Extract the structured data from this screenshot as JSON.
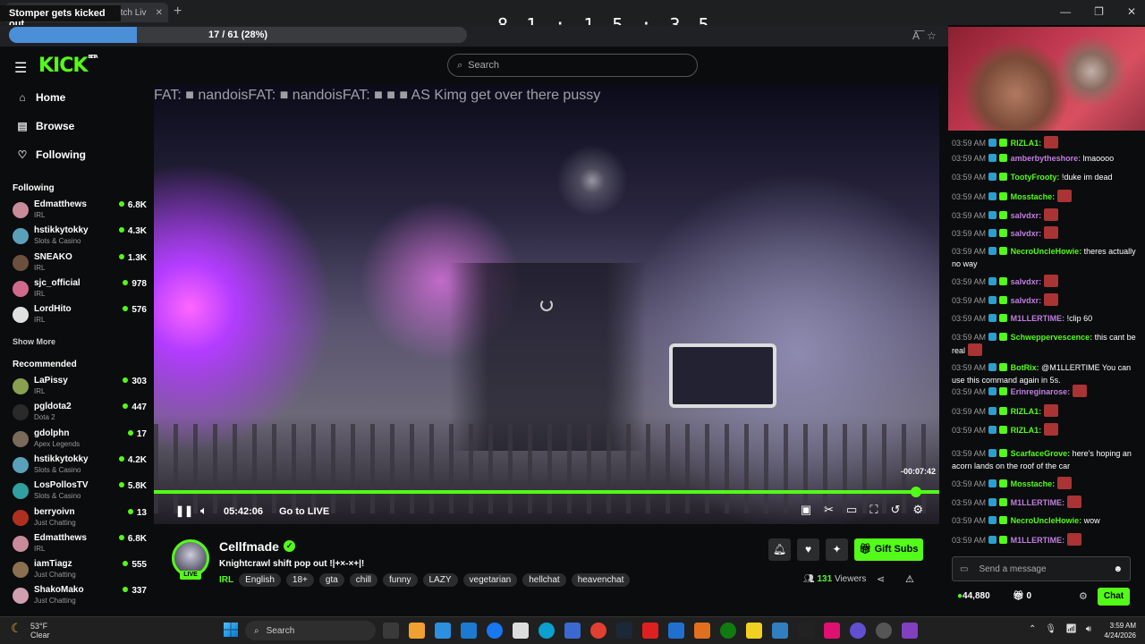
{
  "browser": {
    "tab_title": "Watch Liv",
    "overlay_title": "Stomper gets kicked out",
    "counter": "8 1 : 1 5 : 3 5",
    "progress_label": "17 / 61 (28%)",
    "progress_fraction": 0.28
  },
  "header": {
    "logo": "KICK",
    "logo_badge": "BETA",
    "search_placeholder": "Search"
  },
  "sidebar": {
    "nav": [
      {
        "label": "Home",
        "icon": "home-icon"
      },
      {
        "label": "Browse",
        "icon": "browse-icon"
      },
      {
        "label": "Following",
        "icon": "heart-icon"
      }
    ],
    "following_title": "Following",
    "following": [
      {
        "name": "Edmatthews",
        "category": "IRL",
        "viewers": "6.8K",
        "color": "#c98a9a"
      },
      {
        "name": "hstikkytokky",
        "category": "Slots & Casino",
        "viewers": "4.3K",
        "color": "#5aa0b8"
      },
      {
        "name": "SNEAKO",
        "category": "IRL",
        "viewers": "1.3K",
        "color": "#6b5040"
      },
      {
        "name": "sjc_official",
        "category": "IRL",
        "viewers": "978",
        "color": "#d06a8a"
      },
      {
        "name": "LordHito",
        "category": "IRL",
        "viewers": "576",
        "color": "#e0e0e0"
      }
    ],
    "show_more": "Show More",
    "recommended_title": "Recommended",
    "recommended": [
      {
        "name": "LaPissy",
        "category": "IRL",
        "viewers": "303",
        "color": "#8aa050"
      },
      {
        "name": "pgldota2",
        "category": "Dota 2",
        "viewers": "447",
        "color": "#2a2a2a"
      },
      {
        "name": "gdolphn",
        "category": "Apex Legends",
        "viewers": "17",
        "color": "#7a6a5a"
      },
      {
        "name": "hstikkytokky",
        "category": "Slots & Casino",
        "viewers": "4.2K",
        "color": "#5aa0b8"
      },
      {
        "name": "LosPollosTV",
        "category": "Slots & Casino",
        "viewers": "5.8K",
        "color": "#30a0a0"
      },
      {
        "name": "berryoivn",
        "category": "Just Chatting",
        "viewers": "13",
        "color": "#b03020"
      },
      {
        "name": "Edmatthews",
        "category": "IRL",
        "viewers": "6.8K",
        "color": "#c98a9a"
      },
      {
        "name": "iamTiagz",
        "category": "Just Chatting",
        "viewers": "555",
        "color": "#8a7050"
      },
      {
        "name": "ShakoMako",
        "category": "Just Chatting",
        "viewers": "337",
        "color": "#d0a0b0"
      }
    ]
  },
  "video": {
    "overlay_chat": "FAT: ■ nandoisFAT: ■ nandoisFAT: ■ ■ ■ AS Kimg  get over there pussy",
    "time_left": "-00:07:42",
    "position_fraction": 0.97,
    "time": "05:42:06",
    "go_live": "Go to LIVE"
  },
  "stream": {
    "streamer": "Cellfmade",
    "live": "LIVE",
    "title": "Knightcrawl shift pop out  !|+×-×+|!",
    "category": "IRL",
    "tags": [
      "English",
      "18+",
      "gta",
      "chill",
      "funny",
      "LAZY",
      "vegetarian",
      "hellchat",
      "heavenchat"
    ],
    "gift_label": "Gift Subs",
    "viewers_count": "131",
    "viewers_label": "Viewers"
  },
  "chat": {
    "messages": [
      {
        "ts": "03:59 AM",
        "user": "RIZLA1:",
        "color": "#53fc18",
        "text": "",
        "emote": true
      },
      {
        "ts": "03:59 AM",
        "user": "amberbytheshore:",
        "color": "#c07fe0",
        "text": "lmaoooo",
        "emote": false
      },
      {
        "ts": "03:59 AM",
        "user": "TootyFrooty:",
        "color": "#53fc18",
        "text": "!duke im dead",
        "emote": false
      },
      {
        "ts": "03:59 AM",
        "user": "Mosstache:",
        "color": "#53fc18",
        "text": "",
        "emote": true
      },
      {
        "ts": "03:59 AM",
        "user": "salvdxr:",
        "color": "#c07fe0",
        "text": "",
        "emote": true
      },
      {
        "ts": "03:59 AM",
        "user": "salvdxr:",
        "color": "#c07fe0",
        "text": "",
        "emote": true
      },
      {
        "ts": "03:59 AM",
        "user": "NecroUncleHowie:",
        "color": "#53fc18",
        "text": "theres actually no way",
        "emote": false
      },
      {
        "ts": "03:59 AM",
        "user": "salvdxr:",
        "color": "#c07fe0",
        "text": "",
        "emote": true
      },
      {
        "ts": "03:59 AM",
        "user": "salvdxr:",
        "color": "#c07fe0",
        "text": "",
        "emote": true
      },
      {
        "ts": "03:59 AM",
        "user": "M1LLERTIME:",
        "color": "#c07fe0",
        "text": "!clip 60",
        "emote": false
      },
      {
        "ts": "03:59 AM",
        "user": "Schweppervescence:",
        "color": "#53fc18",
        "text": "this cant be real",
        "emote": true
      },
      {
        "ts": "03:59 AM",
        "user": "BotRix:",
        "color": "#53fc18",
        "text": "@M1LLERTIME You can use this command again in 5s.",
        "emote": false
      },
      {
        "ts": "03:59 AM",
        "user": "Erinreginarose:",
        "color": "#c07fe0",
        "text": "",
        "emote": true
      },
      {
        "ts": "03:59 AM",
        "user": "RIZLA1:",
        "color": "#53fc18",
        "text": "",
        "emote": true
      },
      {
        "ts": "03:59 AM",
        "user": "RIZLA1:",
        "color": "#53fc18",
        "text": "",
        "emote": true
      },
      {
        "ts": "03:59 AM",
        "user": "ScarfaceGrove:",
        "color": "#53fc18",
        "text": "here's hoping an acorn lands on the roof of the car",
        "emote": false
      },
      {
        "ts": "03:59 AM",
        "user": "Mosstache:",
        "color": "#53fc18",
        "text": "",
        "emote": true
      },
      {
        "ts": "03:59 AM",
        "user": "M1LLERTIME:",
        "color": "#c07fe0",
        "text": "",
        "emote": true
      },
      {
        "ts": "03:59 AM",
        "user": "NecroUncleHowie:",
        "color": "#53fc18",
        "text": "wow",
        "emote": false
      },
      {
        "ts": "03:59 AM",
        "user": "M1LLERTIME:",
        "color": "#c07fe0",
        "text": "",
        "emote": true
      }
    ],
    "input_placeholder": "Send a message",
    "points": "44,880",
    "gifts": "0",
    "chat_button": "Chat"
  },
  "taskbar": {
    "weather_temp": "53°F",
    "weather_text": "Clear",
    "search": "Search",
    "time": "3:59 AM",
    "date": "4/24/2026"
  }
}
